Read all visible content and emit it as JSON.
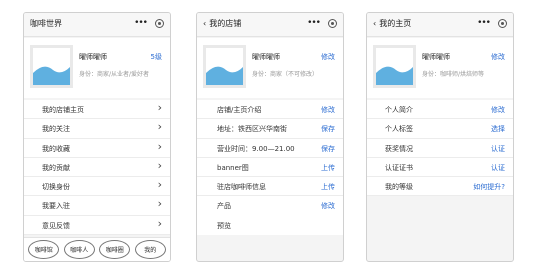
{
  "screens": [
    {
      "title": "咖啡世界",
      "back": "",
      "dots": "•••",
      "profile": {
        "name": "曜师曜师",
        "sub": "身份：商家/从业者/爱好者",
        "link": "5级"
      },
      "rows": [
        {
          "label": "我的店铺主页",
          "action": "›"
        },
        {
          "label": "我的关注",
          "action": "›"
        },
        {
          "label": "我的收藏",
          "action": "›"
        },
        {
          "label": "我的贡献",
          "action": "›"
        },
        {
          "label": "切换身份",
          "action": "›"
        },
        {
          "label": "我要入驻",
          "action": "›"
        },
        {
          "label": "意见反馈",
          "action": "›"
        }
      ],
      "tabs": [
        "咖啡馆",
        "咖啡人",
        "咖啡圈",
        "我的"
      ]
    },
    {
      "title": "我的店铺",
      "back": "‹",
      "dots": "•••",
      "profile": {
        "name": "曜师曜师",
        "sub": "身份：商家（不可修改）",
        "link": "修改"
      },
      "rows": [
        {
          "label": "店铺/主页介绍",
          "action": "修改"
        },
        {
          "label": "地址：铁西区兴华南街",
          "action": "保存"
        },
        {
          "label": "营业时间：9.00—21.00",
          "action": "保存"
        },
        {
          "label": "banner图",
          "action": "上传"
        },
        {
          "label": "驻店咖啡师信息",
          "action": "上传"
        },
        {
          "label": "产品",
          "action": "修改"
        },
        {
          "label": "预览",
          "action": ""
        }
      ]
    },
    {
      "title": "我的主页",
      "back": "‹",
      "dots": "•••",
      "profile": {
        "name": "曜师曜师",
        "sub": "身份：咖啡师/烘焙师等",
        "link": "修改"
      },
      "rows": [
        {
          "label": "个人简介",
          "action": "修改"
        },
        {
          "label": "个人标签",
          "action": "选择"
        },
        {
          "label": "获奖情况",
          "action": "认证"
        },
        {
          "label": "认证证书",
          "action": "认证"
        },
        {
          "label": "我的等级",
          "action": "如何提升?"
        }
      ]
    }
  ],
  "colors": {
    "link": "#2a6bd1",
    "avatar_bg": "#e9e9e9",
    "avatar_sky": "#5fb0e0"
  },
  "icons": [
    "chevron-left-icon",
    "more-dots-icon",
    "target-icon",
    "avatar-placeholder-icon",
    "chevron-right-icon"
  ]
}
